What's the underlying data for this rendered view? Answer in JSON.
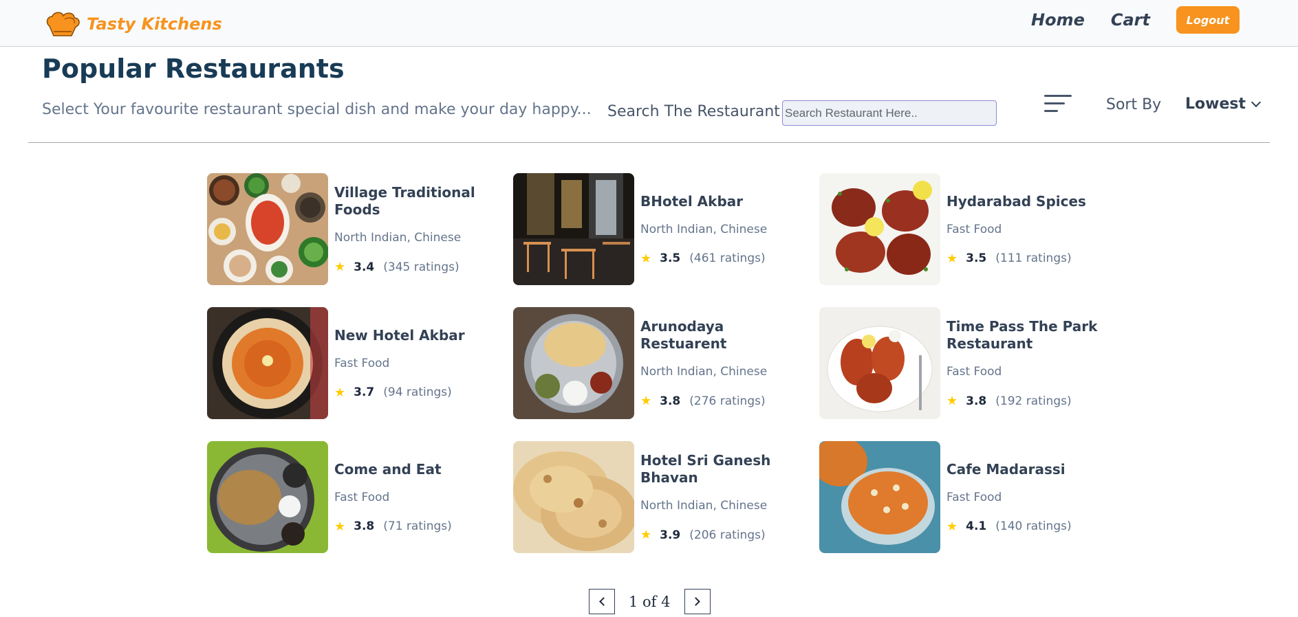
{
  "navbar": {
    "brand": "Tasty Kitchens",
    "links": [
      "Home",
      "Cart"
    ],
    "logout_label": "Logout",
    "brand_color": "#f7931e"
  },
  "header": {
    "title": "Popular Restaurants",
    "description": "Select Your favourite restaurant special dish and make your day happy...",
    "search_label": "Search The Restaurant",
    "search_placeholder": "Search Restaurant Here..",
    "sort_label": "Sort By",
    "sort_value": "Lowest"
  },
  "restaurants": [
    {
      "name": "Village Traditional Foods",
      "cuisine": "North Indian, Chinese",
      "rating": "3.4",
      "ratings_count": "(345 ratings)",
      "image": "platters"
    },
    {
      "name": "BHotel Akbar",
      "cuisine": "North Indian, Chinese",
      "rating": "3.5",
      "ratings_count": "(461 ratings)",
      "image": "interior"
    },
    {
      "name": "Hydarabad Spices",
      "cuisine": "Fast Food",
      "rating": "3.5",
      "ratings_count": "(111 ratings)",
      "image": "chicken"
    },
    {
      "name": "New Hotel Akbar",
      "cuisine": "Fast Food",
      "rating": "3.7",
      "ratings_count": "(94 ratings)",
      "image": "pav-bhaji"
    },
    {
      "name": "Arunodaya Restuarent",
      "cuisine": "North Indian, Chinese",
      "rating": "3.8",
      "ratings_count": "(276 ratings)",
      "image": "thali"
    },
    {
      "name": "Time Pass The Park Restaurant",
      "cuisine": "Fast Food",
      "rating": "3.8",
      "ratings_count": "(192 ratings)",
      "image": "drumsticks"
    },
    {
      "name": "Come and Eat",
      "cuisine": "Fast Food",
      "rating": "3.8",
      "ratings_count": "(71 ratings)",
      "image": "paratha-plate"
    },
    {
      "name": "Hotel Sri Ganesh Bhavan",
      "cuisine": "North Indian, Chinese",
      "rating": "3.9",
      "ratings_count": "(206 ratings)",
      "image": "parotta"
    },
    {
      "name": "Cafe Madarassi",
      "cuisine": "Fast Food",
      "rating": "4.1",
      "ratings_count": "(140 ratings)",
      "image": "halwa"
    }
  ],
  "pagination": {
    "text": "1 of 4"
  }
}
